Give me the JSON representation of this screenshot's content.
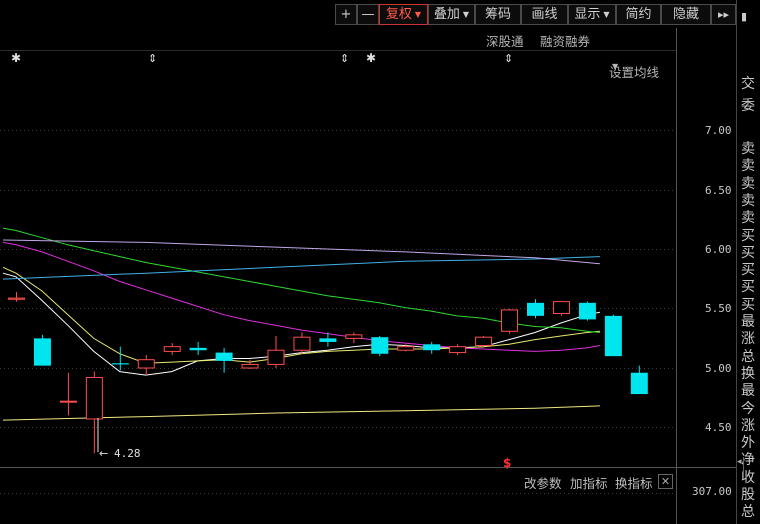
{
  "toolbar": {
    "plus": "+",
    "minus": "—",
    "fuquan": "复权",
    "diejia": "叠加",
    "chouma": "筹码",
    "huaxian": "画线",
    "xianshi": "显示",
    "jianyue": "简约",
    "yincang": "隐藏",
    "more": "▸▸",
    "top_right_glyph": "▮"
  },
  "subbar": {
    "shengutong": "深股通",
    "rongzi": "融资融券",
    "junxian": "设置均线"
  },
  "markers": {
    "star": "✱",
    "updown": "⇕",
    "dollar": "$"
  },
  "bottombar": {
    "gaicanshu": "改参数",
    "jiazhibiao": "加指标",
    "huanzhibiao": "换指标",
    "close": "✕"
  },
  "volume_axis_label": "307.00",
  "low_annotation": "4.28",
  "right_panel_labels": [
    "交",
    "委",
    "卖",
    "卖",
    "卖",
    "卖",
    "卖",
    "买",
    "买",
    "买",
    "买",
    "买",
    "最",
    "涨",
    "总",
    "换",
    "最",
    "今",
    "涨",
    "外",
    "净",
    "收",
    "股",
    "总"
  ],
  "colors": {
    "up": "#ff4d4d",
    "down": "#00e5ee",
    "ma5": "#ffffff",
    "ma10": "#e8e870",
    "ma20": "#e030e0",
    "ma60": "#30d830",
    "ma120": "#40b0e8",
    "ma250": "#c0a8e8",
    "ma_low": "#f0e880"
  },
  "chart_data": {
    "type": "candlestick",
    "y_ticks": [
      "7.00",
      "6.50",
      "6.00",
      "5.50",
      "5.00",
      "4.50"
    ],
    "ylim": [
      4.2,
      7.25
    ],
    "candles": [
      {
        "o": 5.58,
        "h": 5.64,
        "l": 5.56,
        "c": 5.59
      },
      {
        "o": 5.25,
        "h": 5.28,
        "l": 5.02,
        "c": 5.02
      },
      {
        "o": 4.72,
        "h": 4.96,
        "l": 4.6,
        "c": 4.72
      },
      {
        "o": 4.57,
        "h": 4.97,
        "l": 4.28,
        "c": 4.92
      },
      {
        "o": 5.04,
        "h": 5.18,
        "l": 4.98,
        "c": 5.03
      },
      {
        "o": 5.0,
        "h": 5.11,
        "l": 4.94,
        "c": 5.07
      },
      {
        "o": 5.14,
        "h": 5.21,
        "l": 5.11,
        "c": 5.18
      },
      {
        "o": 5.17,
        "h": 5.22,
        "l": 5.11,
        "c": 5.15
      },
      {
        "o": 5.13,
        "h": 5.17,
        "l": 4.96,
        "c": 5.06
      },
      {
        "o": 5.0,
        "h": 5.07,
        "l": 4.99,
        "c": 5.03
      },
      {
        "o": 5.03,
        "h": 5.27,
        "l": 5.0,
        "c": 5.15
      },
      {
        "o": 5.15,
        "h": 5.3,
        "l": 5.12,
        "c": 5.26
      },
      {
        "o": 5.25,
        "h": 5.3,
        "l": 5.18,
        "c": 5.22
      },
      {
        "o": 5.25,
        "h": 5.3,
        "l": 5.21,
        "c": 5.28
      },
      {
        "o": 5.26,
        "h": 5.27,
        "l": 5.1,
        "c": 5.12
      },
      {
        "o": 5.15,
        "h": 5.2,
        "l": 5.14,
        "c": 5.18
      },
      {
        "o": 5.2,
        "h": 5.22,
        "l": 5.12,
        "c": 5.15
      },
      {
        "o": 5.13,
        "h": 5.2,
        "l": 5.11,
        "c": 5.18
      },
      {
        "o": 5.19,
        "h": 5.27,
        "l": 5.17,
        "c": 5.26
      },
      {
        "o": 5.31,
        "h": 5.5,
        "l": 5.29,
        "c": 5.49
      },
      {
        "o": 5.55,
        "h": 5.58,
        "l": 5.42,
        "c": 5.44
      },
      {
        "o": 5.46,
        "h": 5.56,
        "l": 5.44,
        "c": 5.56
      },
      {
        "o": 5.55,
        "h": 5.56,
        "l": 5.4,
        "c": 5.41
      },
      {
        "o": 5.44,
        "h": 5.45,
        "l": 5.1,
        "c": 5.1
      },
      {
        "o": 4.96,
        "h": 5.02,
        "l": 4.78,
        "c": 4.78
      }
    ],
    "ma": [
      {
        "name": "MA5",
        "color": "#ffffff",
        "points": [
          [
            -0.5,
            5.8
          ],
          [
            0,
            5.77
          ],
          [
            1,
            5.57
          ],
          [
            2,
            5.36
          ],
          [
            3,
            5.14
          ],
          [
            4,
            4.97
          ],
          [
            5,
            4.94
          ],
          [
            6,
            4.97
          ],
          [
            7,
            5.06
          ],
          [
            8,
            5.08
          ],
          [
            9,
            5.08
          ],
          [
            10,
            5.1
          ],
          [
            11,
            5.13
          ],
          [
            12,
            5.15
          ],
          [
            13,
            5.18
          ],
          [
            14,
            5.2
          ],
          [
            15,
            5.19
          ],
          [
            16,
            5.17
          ],
          [
            17,
            5.17
          ],
          [
            18,
            5.18
          ],
          [
            19,
            5.24
          ],
          [
            20,
            5.3
          ],
          [
            21,
            5.38
          ],
          [
            22,
            5.45
          ],
          [
            22.5,
            5.47
          ]
        ]
      },
      {
        "name": "MA10",
        "color": "#e8e870",
        "points": [
          [
            -0.5,
            5.85
          ],
          [
            0,
            5.8
          ],
          [
            1,
            5.65
          ],
          [
            2,
            5.45
          ],
          [
            3,
            5.25
          ],
          [
            4,
            5.12
          ],
          [
            5,
            5.04
          ],
          [
            6,
            5.05
          ],
          [
            7,
            5.06
          ],
          [
            8,
            5.07
          ],
          [
            9,
            5.05
          ],
          [
            10,
            5.08
          ],
          [
            11,
            5.12
          ],
          [
            12,
            5.14
          ],
          [
            13,
            5.15
          ],
          [
            14,
            5.16
          ],
          [
            15,
            5.16
          ],
          [
            16,
            5.16
          ],
          [
            17,
            5.17
          ],
          [
            18,
            5.18
          ],
          [
            19,
            5.2
          ],
          [
            20,
            5.24
          ],
          [
            21,
            5.27
          ],
          [
            22,
            5.3
          ],
          [
            22.5,
            5.31
          ]
        ]
      },
      {
        "name": "MA20",
        "color": "#e030e0",
        "points": [
          [
            -0.5,
            6.06
          ],
          [
            0,
            6.04
          ],
          [
            1,
            5.98
          ],
          [
            2,
            5.9
          ],
          [
            3,
            5.82
          ],
          [
            4,
            5.73
          ],
          [
            5,
            5.66
          ],
          [
            6,
            5.59
          ],
          [
            7,
            5.52
          ],
          [
            8,
            5.45
          ],
          [
            9,
            5.4
          ],
          [
            10,
            5.36
          ],
          [
            11,
            5.32
          ],
          [
            12,
            5.29
          ],
          [
            13,
            5.26
          ],
          [
            14,
            5.23
          ],
          [
            15,
            5.21
          ],
          [
            16,
            5.19
          ],
          [
            17,
            5.17
          ],
          [
            18,
            5.16
          ],
          [
            19,
            5.15
          ],
          [
            20,
            5.14
          ],
          [
            21,
            5.15
          ],
          [
            22,
            5.17
          ],
          [
            22.5,
            5.19
          ]
        ]
      },
      {
        "name": "MA60",
        "color": "#30d830",
        "points": [
          [
            -0.5,
            6.18
          ],
          [
            0,
            6.16
          ],
          [
            1,
            6.1
          ],
          [
            2,
            6.04
          ],
          [
            3,
            5.99
          ],
          [
            4,
            5.94
          ],
          [
            5,
            5.89
          ],
          [
            6,
            5.85
          ],
          [
            7,
            5.81
          ],
          [
            8,
            5.77
          ],
          [
            9,
            5.73
          ],
          [
            10,
            5.69
          ],
          [
            11,
            5.65
          ],
          [
            12,
            5.61
          ],
          [
            13,
            5.58
          ],
          [
            14,
            5.55
          ],
          [
            15,
            5.51
          ],
          [
            16,
            5.48
          ],
          [
            17,
            5.44
          ],
          [
            18,
            5.42
          ],
          [
            19,
            5.38
          ],
          [
            20,
            5.35
          ],
          [
            21,
            5.34
          ],
          [
            22,
            5.31
          ],
          [
            22.5,
            5.3
          ]
        ]
      },
      {
        "name": "MA120",
        "color": "#40b0e8",
        "points": [
          [
            -0.5,
            5.75
          ],
          [
            5,
            5.8
          ],
          [
            10,
            5.85
          ],
          [
            15,
            5.9
          ],
          [
            20,
            5.92
          ],
          [
            22.5,
            5.94
          ]
        ]
      },
      {
        "name": "MA250",
        "color": "#c0a8e8",
        "points": [
          [
            -0.5,
            6.08
          ],
          [
            5,
            6.06
          ],
          [
            10,
            6.02
          ],
          [
            15,
            5.98
          ],
          [
            20,
            5.93
          ],
          [
            22.5,
            5.88
          ]
        ]
      },
      {
        "name": "MA_LOW",
        "color": "#f0e880",
        "points": [
          [
            -0.5,
            4.56
          ],
          [
            5,
            4.59
          ],
          [
            10,
            4.62
          ],
          [
            15,
            4.64
          ],
          [
            20,
            4.66
          ],
          [
            22.5,
            4.68
          ]
        ]
      }
    ]
  }
}
